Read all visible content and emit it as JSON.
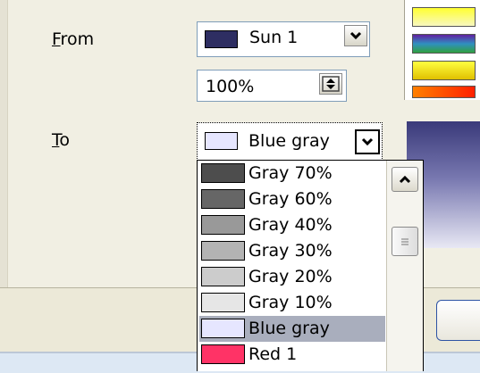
{
  "from": {
    "label_key": "F",
    "label_rest": "rom",
    "color_name": "Sun 1",
    "color_hex": "#2e2e62",
    "intensity": "100%"
  },
  "to": {
    "label_key": "T",
    "label_rest": "o",
    "color_name": "Blue gray",
    "color_hex": "#e6e6ff"
  },
  "color_list": [
    {
      "name": "Gray 70%",
      "hex": "#4d4d4d"
    },
    {
      "name": "Gray 60%",
      "hex": "#666666"
    },
    {
      "name": "Gray 40%",
      "hex": "#999999"
    },
    {
      "name": "Gray 30%",
      "hex": "#b3b3b3"
    },
    {
      "name": "Gray 20%",
      "hex": "#cccccc"
    },
    {
      "name": "Gray 10%",
      "hex": "#e6e6e6"
    },
    {
      "name": "Blue gray",
      "hex": "#e6e6ff",
      "selected": true
    },
    {
      "name": "Red 1",
      "hex": "#ff3366"
    }
  ],
  "icons": {
    "dropdown": "chevron-down-icon",
    "spin": "spin-arrows-icon",
    "scroll_up": "chevron-up-icon",
    "thumb": "scroll-thumb-grip-icon"
  }
}
